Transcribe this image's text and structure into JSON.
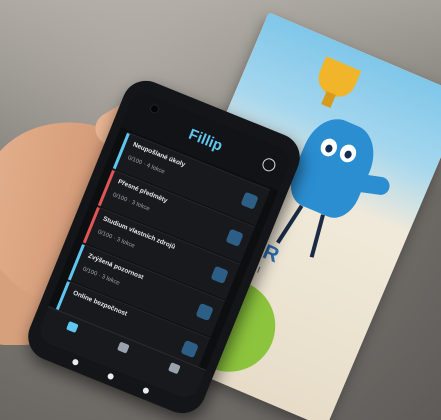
{
  "app": {
    "title": "Fillip"
  },
  "cards": [
    {
      "title": "Neupošlané úkoly",
      "meta": "0/100 · 4 lekce",
      "accent": "#5fc7ef"
    },
    {
      "title": "Přesné předměty",
      "meta": "0/100 · 3 lekce",
      "accent": "#e05555"
    },
    {
      "title": "Studium vlastních zdrojů",
      "meta": "0/100 · 3 lekce",
      "accent": "#e05555"
    },
    {
      "title": "Zvýšená pozornost",
      "meta": "0/100 · 3 lekce",
      "accent": "#5fc7ef"
    },
    {
      "title": "Online bezpečnost",
      "meta": "",
      "accent": "#5fc7ef"
    }
  ],
  "nav": [
    {
      "label": "",
      "active": true
    },
    {
      "label": "",
      "active": false
    },
    {
      "label": "",
      "active": false
    }
  ],
  "leaflet": {
    "title": "POHÁR",
    "subtitle": "SAMOTNOSTI",
    "badge": ""
  },
  "colors": {
    "accent": "#5fc7ef",
    "screen_bg": "#0d0e10",
    "mascot": "#2b8ed1",
    "badge": "#8cc43d"
  }
}
